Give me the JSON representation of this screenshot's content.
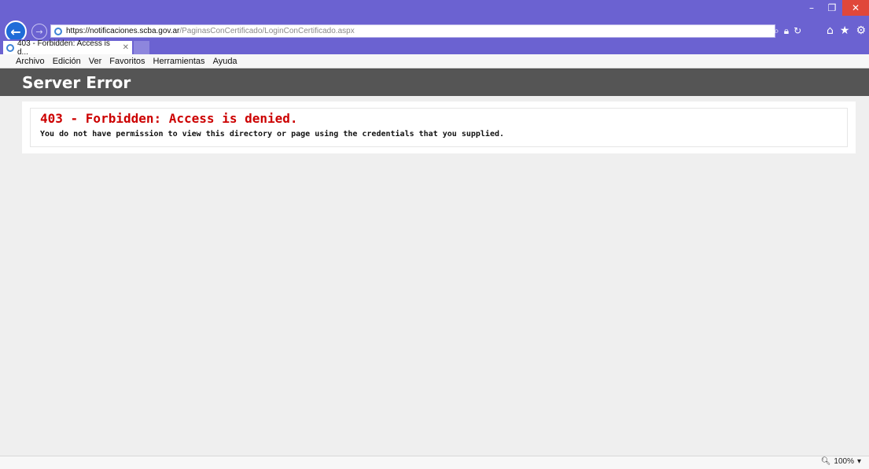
{
  "browser": {
    "url_host": "https://notificaciones.scba.gov.ar",
    "url_path": "/PaginasConCertificado/LoginConCertificado.aspx",
    "tab_title": "403 - Forbidden: Access is d...",
    "icons": [
      "back-arrow-icon",
      "forward-arrow-icon",
      "search-icon",
      "lock-icon",
      "refresh-icon",
      "home-icon",
      "favorites-star-icon",
      "gear-icon"
    ]
  },
  "menubar": {
    "items": [
      "Archivo",
      "Edición",
      "Ver",
      "Favoritos",
      "Herramientas",
      "Ayuda"
    ]
  },
  "page": {
    "header": "Server Error",
    "error_title": "403 - Forbidden: Access is denied.",
    "error_message": "You do not have permission to view this directory or page using the credentials that you supplied."
  },
  "statusbar": {
    "zoom": "100%"
  },
  "colors": {
    "chrome": "#6b62d1",
    "header_bg": "#555555",
    "error_red": "#cc0000"
  }
}
